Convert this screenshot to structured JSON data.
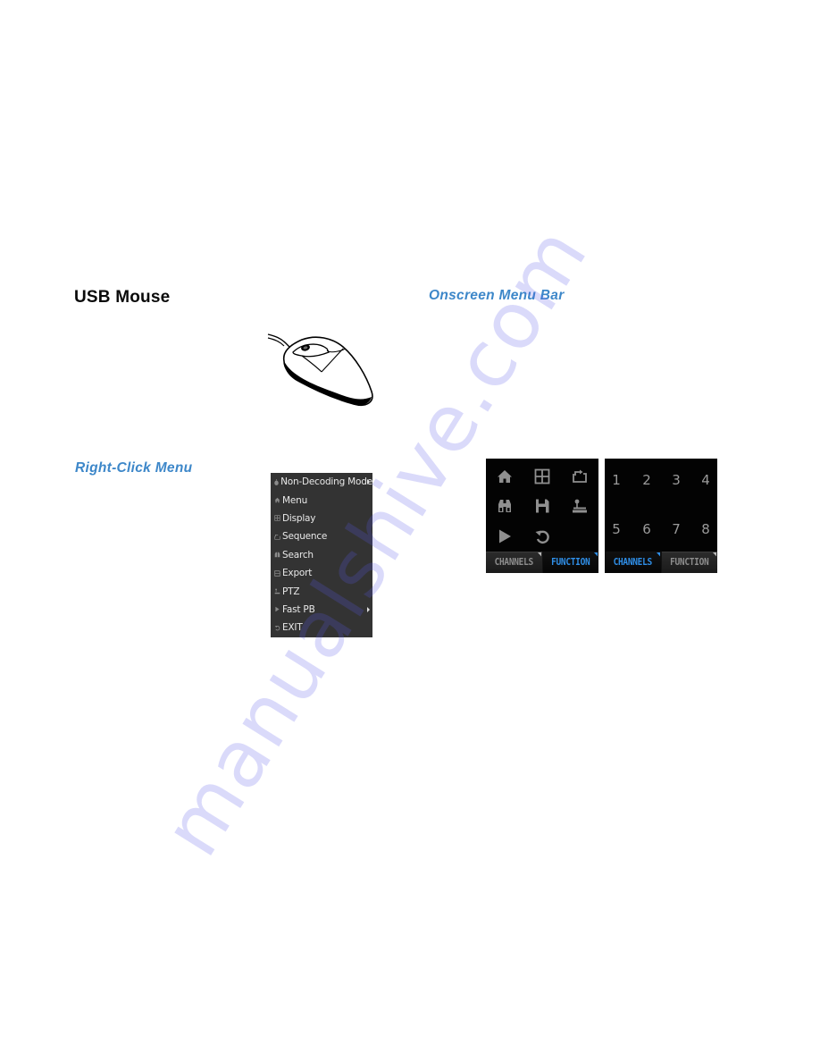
{
  "sections": {
    "usb_mouse": {
      "title": "USB Mouse"
    },
    "onscreen_menu_bar": {
      "title": "Onscreen Menu Bar"
    },
    "right_click_menu": {
      "title": "Right-Click Menu"
    }
  },
  "context_menu": {
    "items": [
      {
        "label": "Non-Decoding Mode",
        "icon": "mouse-icon",
        "submenu": true
      },
      {
        "label": "Menu",
        "icon": "home-icon",
        "submenu": false
      },
      {
        "label": "Display",
        "icon": "grid-icon",
        "submenu": false
      },
      {
        "label": "Sequence",
        "icon": "sequence-icon",
        "submenu": false
      },
      {
        "label": "Search",
        "icon": "binoculars-icon",
        "submenu": false
      },
      {
        "label": "Export",
        "icon": "save-icon",
        "submenu": false
      },
      {
        "label": "PTZ",
        "icon": "joystick-icon",
        "submenu": false
      },
      {
        "label": "Fast PB",
        "icon": "play-icon",
        "submenu": true
      },
      {
        "label": "EXIT",
        "icon": "undo-icon",
        "submenu": false
      }
    ]
  },
  "function_panel": {
    "icons": [
      "home-icon",
      "grid-icon",
      "sequence-icon",
      "binoculars-icon",
      "save-icon",
      "joystick-icon",
      "play-icon",
      "undo-icon"
    ],
    "tabs": [
      {
        "label": "CHANNELS",
        "active": false
      },
      {
        "label": "FUNCTION",
        "active": true
      }
    ]
  },
  "channels_panel": {
    "channels": [
      "1",
      "2",
      "3",
      "4",
      "5",
      "6",
      "7",
      "8"
    ],
    "tabs": [
      {
        "label": "CHANNELS",
        "active": true
      },
      {
        "label": "FUNCTION",
        "active": false
      }
    ]
  },
  "colors": {
    "heading_blue": "#3d87c9",
    "active_tab_blue": "#2f8fe8",
    "menu_bg": "#333333",
    "panel_bg": "#030303"
  },
  "watermark": {
    "text": "manualshive.com"
  }
}
